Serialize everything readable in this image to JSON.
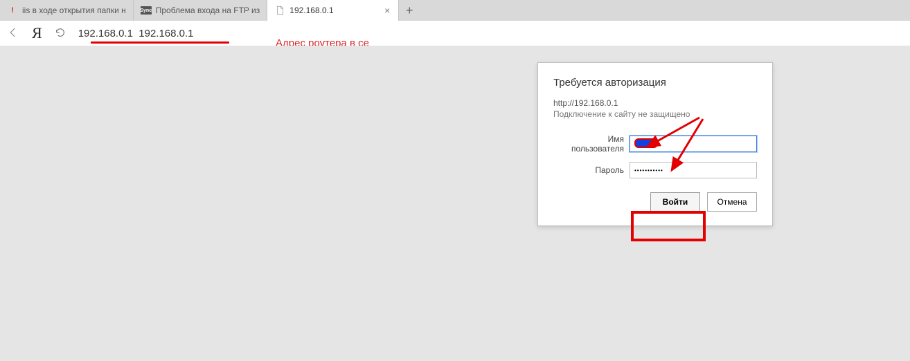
{
  "tabs": [
    {
      "label": "iis в ходе открытия папки н",
      "favicon": "red-exclaim"
    },
    {
      "label": "Проблема входа на FTP из",
      "favicon": "sync"
    },
    {
      "label": "192.168.0.1",
      "favicon": "doc",
      "active": true
    }
  ],
  "address_bar": {
    "text": "192.168.0.1  192.168.0.1",
    "suggestion": "Адрес роутера в се"
  },
  "auth_dialog": {
    "title": "Требуется авторизация",
    "url": "http://192.168.0.1",
    "warning": "Подключение к сайту не защищено",
    "username_label": "Имя пользователя",
    "username_value": "",
    "password_label": "Пароль",
    "password_value": "•••••••••••",
    "login_label": "Войти",
    "cancel_label": "Отмена"
  },
  "annotations": {
    "arrow_color": "#e20000",
    "box_color": "#e20000"
  }
}
